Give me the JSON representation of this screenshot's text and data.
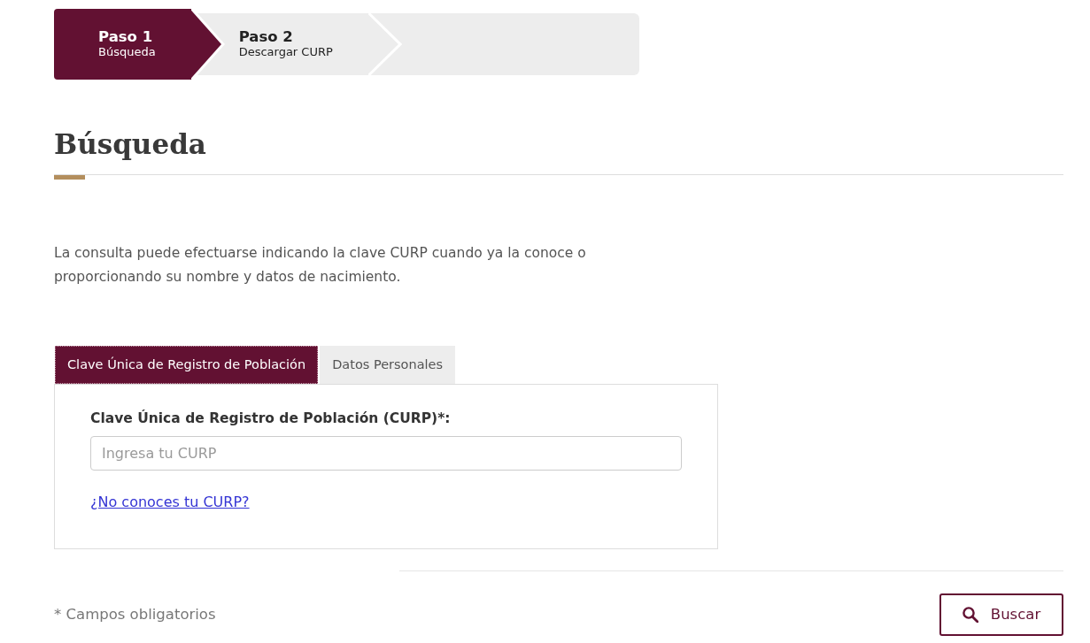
{
  "steps": [
    {
      "title": "Paso 1",
      "subtitle": "Búsqueda",
      "selected": true
    },
    {
      "title": "Paso 2",
      "subtitle": "Descargar CURP",
      "selected": false
    }
  ],
  "heading": "Búsqueda",
  "intro": "La consulta puede efectuarse indicando la clave CURP cuando ya la conoce o proporcionando su nombre y datos de nacimiento.",
  "tabs": [
    {
      "label": "Clave Única de Registro de Población",
      "selected": true
    },
    {
      "label": "Datos Personales",
      "selected": false
    }
  ],
  "form": {
    "label": "Clave Única de Registro de Población (CURP)*:",
    "placeholder": "Ingresa tu CURP",
    "help_link": "¿No conoces tu CURP?"
  },
  "footer": {
    "note": "* Campos obligatorios",
    "button": "Buscar"
  }
}
